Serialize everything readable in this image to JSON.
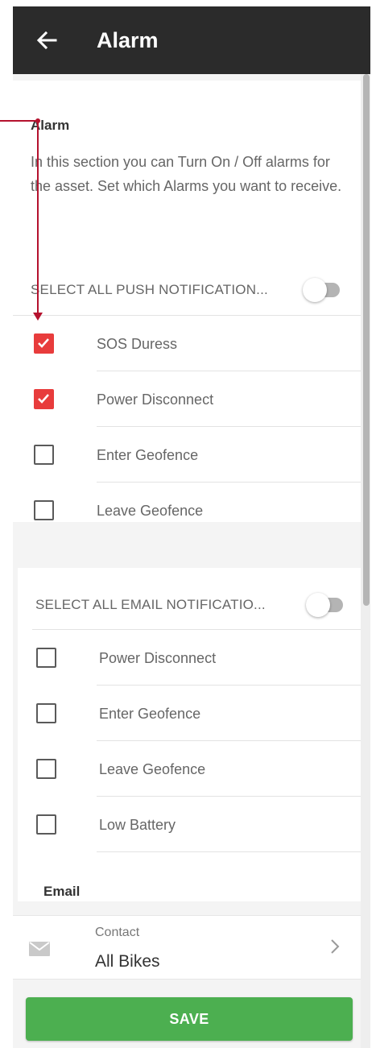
{
  "appbar": {
    "title": "Alarm",
    "back_icon": "arrow-left-icon"
  },
  "intro": {
    "title": "Alarm",
    "description": "In this section you can Turn On / Off alarms for the asset. Set which Alarms you want to receive."
  },
  "push": {
    "select_all_label": "SELECT ALL PUSH NOTIFICATION...",
    "select_all_on": false,
    "items": [
      {
        "label": "SOS Duress",
        "checked": true
      },
      {
        "label": "Power Disconnect",
        "checked": true
      },
      {
        "label": "Enter Geofence",
        "checked": false
      },
      {
        "label": "Leave Geofence",
        "checked": false
      }
    ]
  },
  "email_notifications": {
    "select_all_label": "SELECT ALL EMAIL NOTIFICATIO...",
    "select_all_on": false,
    "items": [
      {
        "label": "Power Disconnect",
        "checked": false
      },
      {
        "label": "Enter Geofence",
        "checked": false
      },
      {
        "label": "Leave Geofence",
        "checked": false
      },
      {
        "label": "Low Battery",
        "checked": false
      }
    ]
  },
  "email_section": {
    "title": "Email",
    "contact_caption": "Contact",
    "contact_value": "All Bikes",
    "icon": "mail-icon",
    "chevron_icon": "chevron-right-icon"
  },
  "save_label": "SAVE",
  "colors": {
    "appbar": "#2b2b2b",
    "checked": "#e83c3c",
    "save": "#4caf50",
    "annotation": "#b5122e"
  }
}
